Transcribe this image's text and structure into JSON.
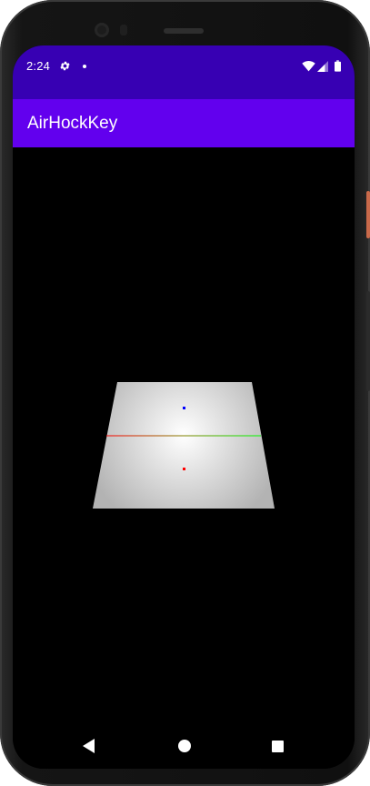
{
  "status_bar": {
    "time": "2:24",
    "icons": [
      "gear-icon",
      "notification-dot-icon",
      "wifi-icon",
      "cell-signal-icon",
      "battery-icon"
    ]
  },
  "app_bar": {
    "title": "AirHockKey"
  },
  "scene": {
    "table_gradient_center": "#ffffff",
    "table_gradient_edge": "#b3b3b3",
    "center_line_left_color": "#ff0000",
    "center_line_right_color": "#00ff00",
    "mallet_top_color": "#0000ff",
    "mallet_bottom_color": "#ff0000",
    "background": "#000000"
  },
  "nav_bar": {
    "icons": [
      "back-icon",
      "home-icon",
      "recents-icon"
    ]
  },
  "colors": {
    "status_bar": "#3700b3",
    "app_bar": "#6200ee",
    "text_on_primary": "#ffffff"
  }
}
